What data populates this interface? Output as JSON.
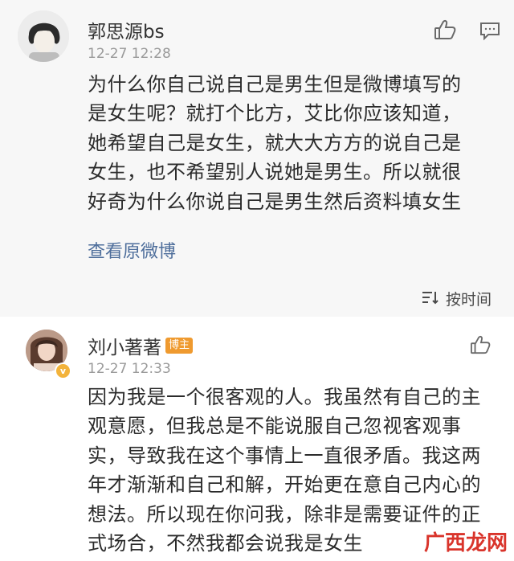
{
  "comment": {
    "username": "郭思源bs",
    "timestamp": "12-27 12:28",
    "lines": [
      "为什么你自己说自己是男生但是微博填写的",
      "是女生呢？就打个比方，艾比你应该知道，",
      "她希望自己是女生，就大大方方的说自己是",
      "女生，也不希望别人说她是男生。所以就很",
      "好奇为什么你说自己是男生然后资料填女生"
    ],
    "view_original_label": "查看原微博"
  },
  "sort": {
    "label": "按时间"
  },
  "reply": {
    "username": "刘小著著",
    "badge": "博主",
    "verified_mark": "v",
    "timestamp": "12-27 12:33",
    "lines": [
      "因为我是一个很客观的人。我虽然有自己的主",
      "观意愿，但我总是不能说服自己忽视客观事",
      "实，导致我在这个事情上一直很矛盾。我这两",
      "年才渐渐和自己和解，开始更在意自己内心的",
      "想法。所以现在你问我，除非是需要证件的正",
      "式场合，不然我都会说我是女生"
    ]
  },
  "watermark": "广西龙网",
  "icons": {
    "like": "thumbs-up-icon",
    "comment": "comment-icon",
    "sort": "sort-icon"
  },
  "colors": {
    "link": "#4e6e9b",
    "badge": "#ef9a2f",
    "watermark": "#d9342b"
  }
}
